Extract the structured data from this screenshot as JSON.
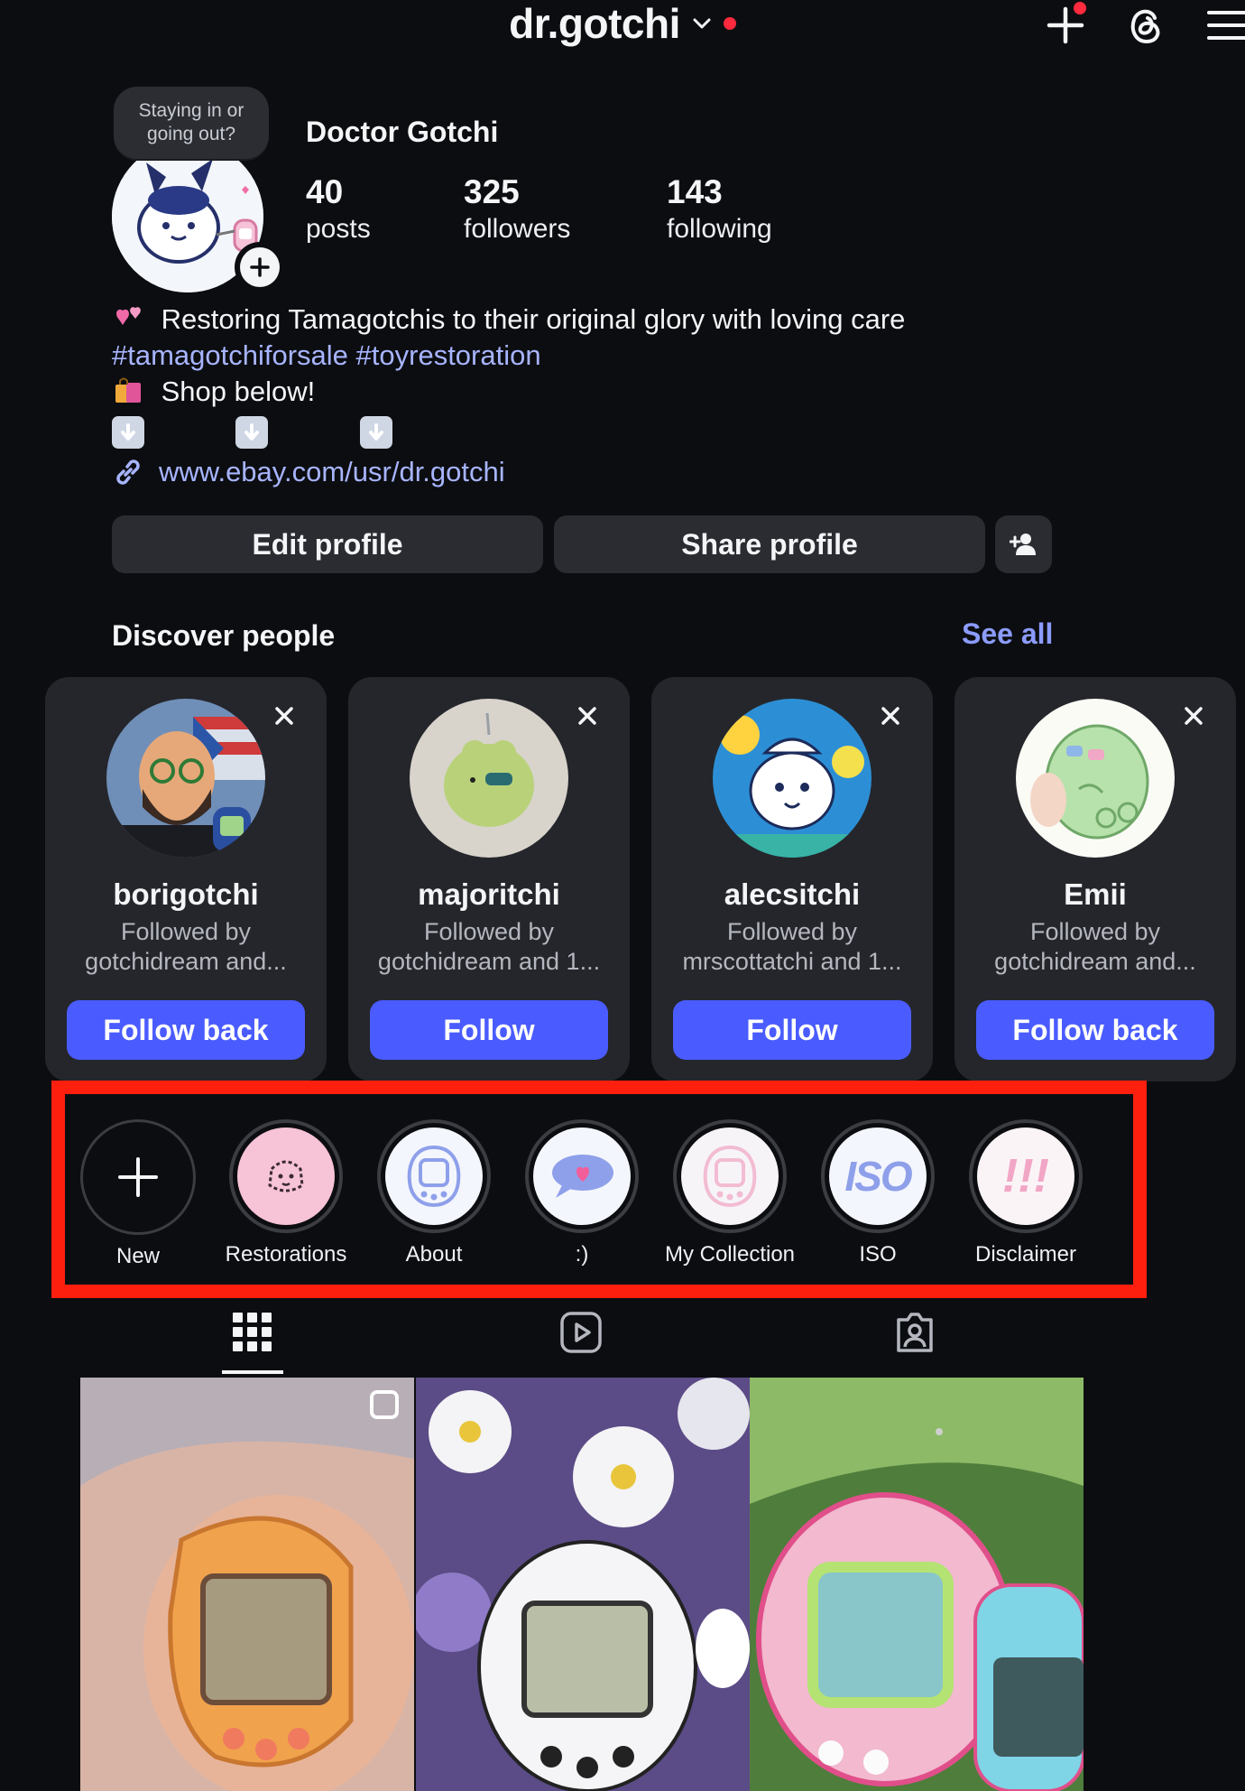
{
  "header": {
    "username": "dr.gotchi",
    "icons": [
      "chevron-down-icon",
      "create-icon",
      "threads-icon",
      "menu-icon"
    ]
  },
  "profile": {
    "note": "Staying in or going out?",
    "display_name": "Doctor Gotchi",
    "stats": [
      {
        "value": "40",
        "label": "posts"
      },
      {
        "value": "325",
        "label": "followers"
      },
      {
        "value": "143",
        "label": "following"
      }
    ],
    "bio_line1": "Restoring Tamagotchis to their original glory with loving care",
    "bio_hashtags": "#tamagotchiforsale #toyrestoration",
    "bio_line3": "Shop below!",
    "link": "www.ebay.com/usr/dr.gotchi"
  },
  "actions": {
    "edit_profile": "Edit profile",
    "share_profile": "Share profile"
  },
  "discover": {
    "title": "Discover people",
    "see_all": "See all",
    "people": [
      {
        "username": "borigotchi",
        "sub": "Followed by gotchidream and...",
        "button": "Follow back"
      },
      {
        "username": "majoritchi",
        "sub": "Followed by gotchidream and 1...",
        "button": "Follow"
      },
      {
        "username": "alecsitchi",
        "sub": "Followed by mrscottatchi and 1...",
        "button": "Follow"
      },
      {
        "username": "Emii",
        "sub": "Followed by gotchidream and...",
        "button": "Follow back"
      }
    ]
  },
  "highlights": [
    {
      "label": "New"
    },
    {
      "label": "Restorations"
    },
    {
      "label": "About"
    },
    {
      "label": ":)"
    },
    {
      "label": "My Collection"
    },
    {
      "label": "ISO"
    },
    {
      "label": "Disclaimer"
    }
  ],
  "highlight_iso_text": "ISO",
  "highlight_disclaimer_text": "!!!",
  "colors": {
    "background": "#0c0d10",
    "accent_button": "#4a5cff",
    "link": "#a7b4ff",
    "highlight_box": "#ff1f0f",
    "notification_dot": "#ff2a3d"
  }
}
